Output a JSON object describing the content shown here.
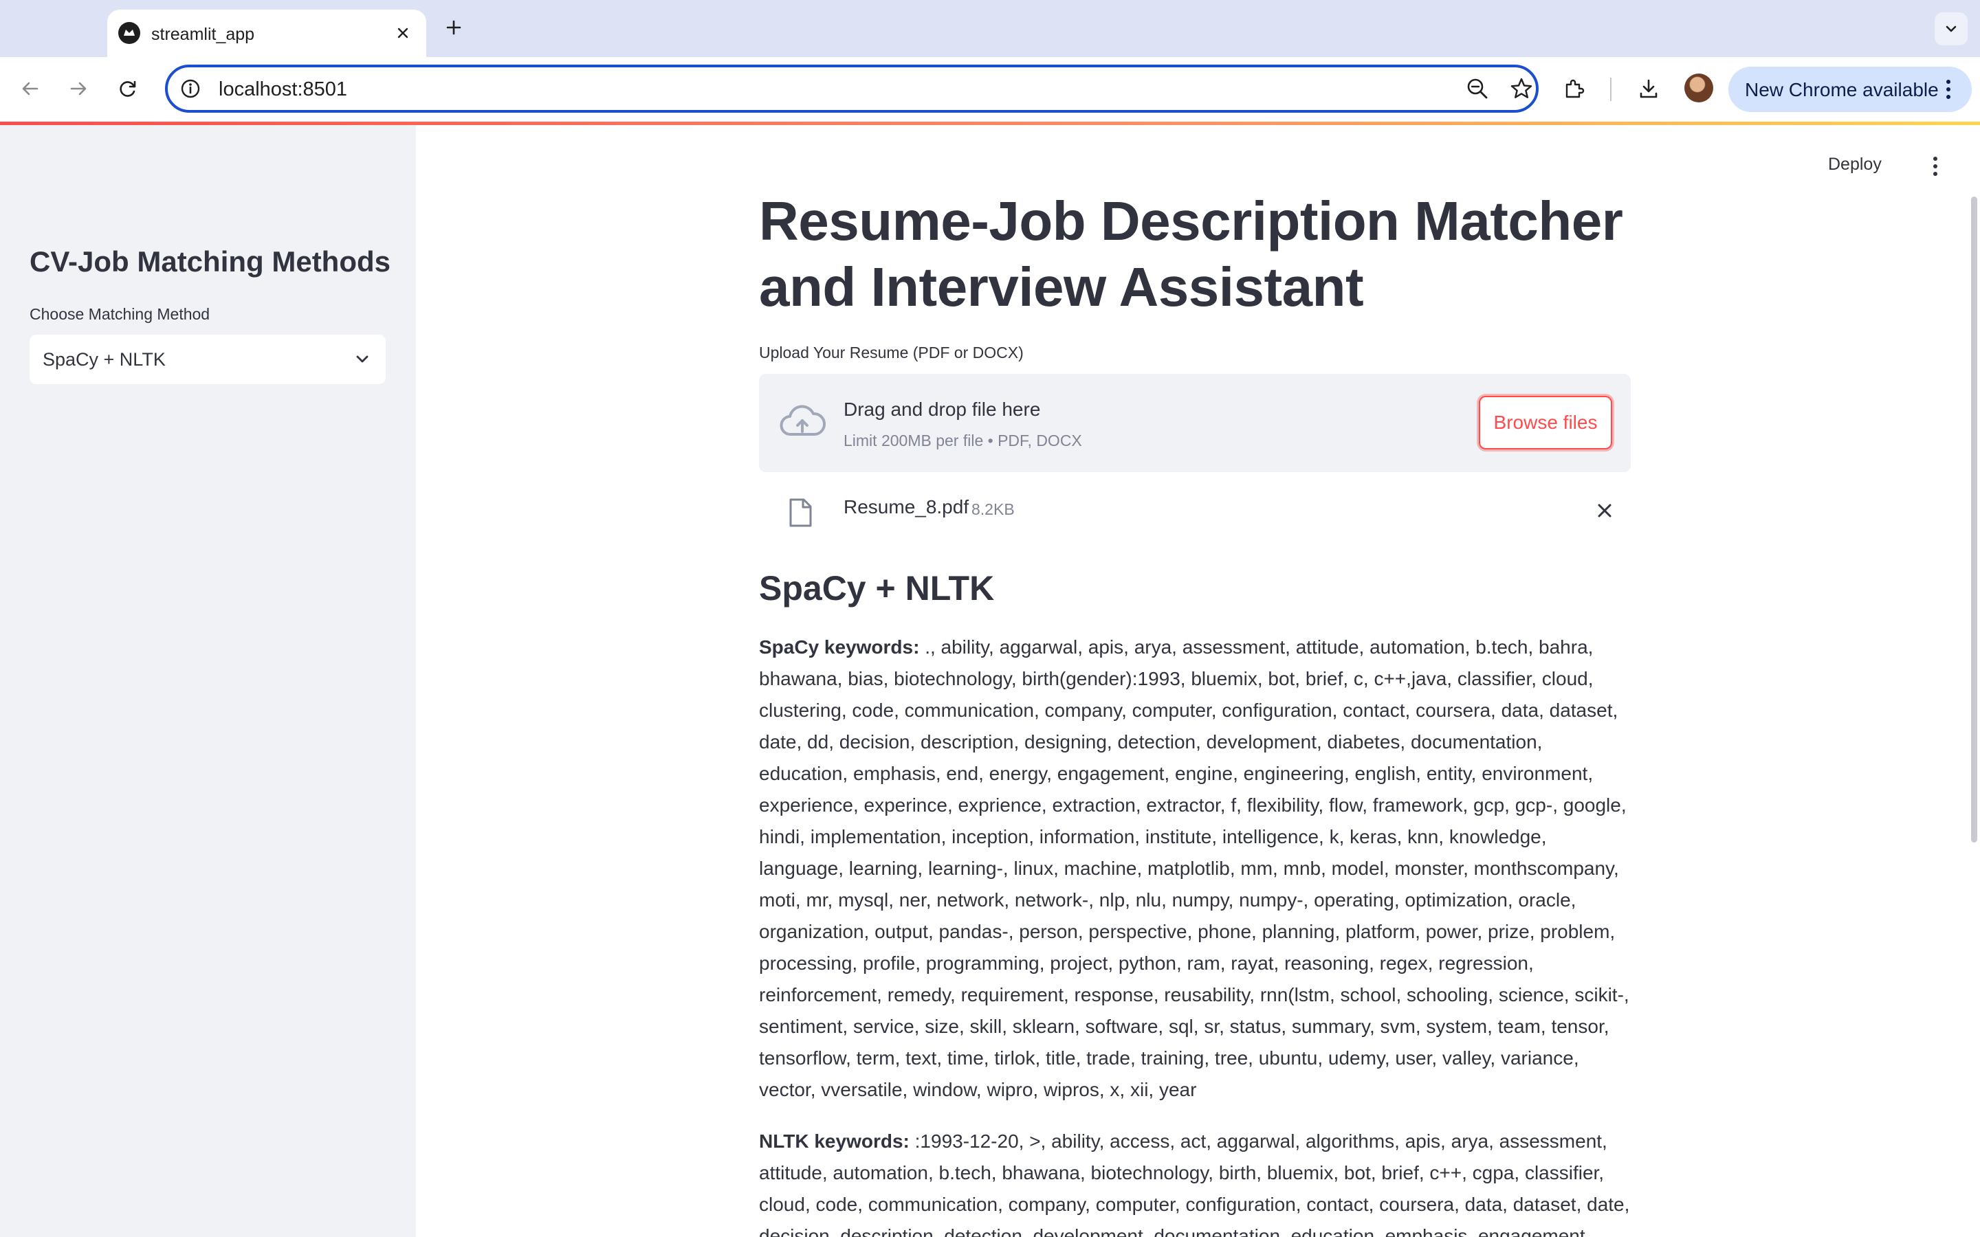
{
  "browser": {
    "tab_title": "streamlit_app",
    "url": "localhost:8501",
    "update_label": "New Chrome available",
    "icons": [
      "streamlit-favicon",
      "close-icon",
      "plus-icon",
      "chevron-down-icon",
      "back-arrow-icon",
      "forward-arrow-icon",
      "reload-icon",
      "info-icon",
      "zoom-icon",
      "star-icon",
      "extensions-icon",
      "download-icon",
      "avatar",
      "kebab-icon"
    ]
  },
  "sidebar": {
    "title": "CV-Job Matching Methods",
    "select_label": "Choose Matching Method",
    "select_value": "SpaCy + NLTK"
  },
  "header": {
    "deploy_label": "Deploy"
  },
  "main": {
    "title": "Resume-Job Description Matcher and Interview Assistant",
    "upload_label": "Upload Your Resume (PDF or DOCX)",
    "dropzone_title": "Drag and drop file here",
    "dropzone_sub": "Limit 200MB per file • PDF, DOCX",
    "browse_label": "Browse files",
    "file_name": "Resume_8.pdf",
    "file_size": "8.2KB",
    "section_heading": "SpaCy + NLTK",
    "spacy_label": "SpaCy keywords:",
    "spacy_keywords": " ., ability, aggarwal, apis, arya, assessment, attitude, automation, b.tech, bahra, bhawana, bias, biotechnology, birth(gender):1993, bluemix, bot, brief, c, c++,java, classifier, cloud, clustering, code, communication, company, computer, configuration, contact, coursera, data, dataset, date, dd, decision, description, designing, detection, development, diabetes, documentation, education, emphasis, end, energy, engagement, engine, engineering, english, entity, environment, experience, experince, exprience, extraction, extractor, f, flexibility, flow, framework, gcp, gcp-, google, hindi, implementation, inception, information, institute, intelligence, k, keras, knn, knowledge, language, learning, learning-, linux, machine, matplotlib, mm, mnb, model, monster, monthscompany, moti, mr, mysql, ner, network, network-, nlp, nlu, numpy, numpy-, operating, optimization, oracle, organization, output, pandas-, person, perspective, phone, planning, platform, power, prize, problem, processing, profile, programming, project, python, ram, rayat, reasoning, regex, regression, reinforcement, remedy, requirement, response, reusability, rnn(lstm, school, schooling, science, scikit-, sentiment, service, size, skill, sklearn, software, sql, sr, status, summary, svm, system, team, tensor, tensorflow, term, text, time, tirlok, title, trade, training, tree, ubuntu, udemy, user, valley, variance, vector, vversatile, window, wipro, wipros, x, xii, year",
    "nltk_label": "NLTK keywords:",
    "nltk_keywords": " :1993-12-20, >, ability, access, act, aggarwal, algorithms, apis, arya, assessment, attitude, automation, b.tech, bhawana, biotechnology, birth, bluemix, bot, brief, c++, cgpa, classifier, cloud, code, communication, company, computer, configuration, contact, coursera, data, dataset, date, decision, description, detection, development, documentation, education, emphasis, engagement, engine"
  }
}
